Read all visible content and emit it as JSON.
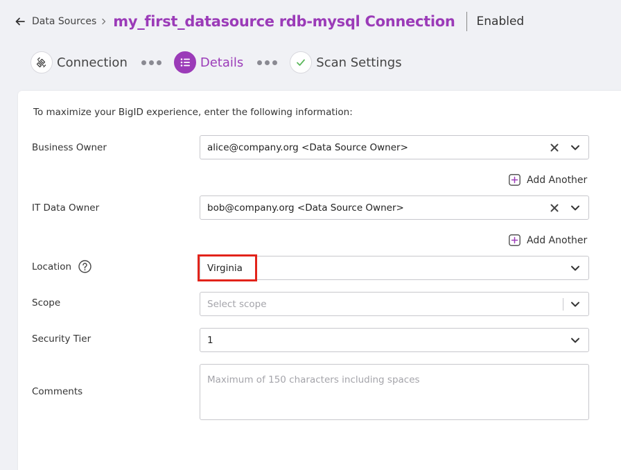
{
  "header": {
    "breadcrumb": "Data Sources",
    "title": "my_first_datasource rdb-mysql Connection",
    "status": "Enabled"
  },
  "stepper": {
    "steps": [
      {
        "label": "Connection",
        "icon": "plug-icon",
        "active": false
      },
      {
        "label": "Details",
        "icon": "list-icon",
        "active": true
      },
      {
        "label": "Scan Settings",
        "icon": "check-icon",
        "active": false
      }
    ]
  },
  "form": {
    "intro": "To maximize your BigID experience, enter the following information:",
    "business_owner": {
      "label": "Business Owner",
      "value": "alice@company.org <Data Source Owner>"
    },
    "it_data_owner": {
      "label": "IT Data Owner",
      "value": "bob@company.org <Data Source Owner>"
    },
    "add_another": "Add Another",
    "location": {
      "label": "Location",
      "value": "Virginia"
    },
    "scope": {
      "label": "Scope",
      "placeholder": "Select scope"
    },
    "security_tier": {
      "label": "Security Tier",
      "value": "1"
    },
    "comments": {
      "label": "Comments",
      "placeholder": "Maximum of 150 characters including spaces"
    }
  },
  "colors": {
    "accent": "#9b3bb8",
    "highlight": "#e2231a",
    "success": "#5cb85c"
  }
}
